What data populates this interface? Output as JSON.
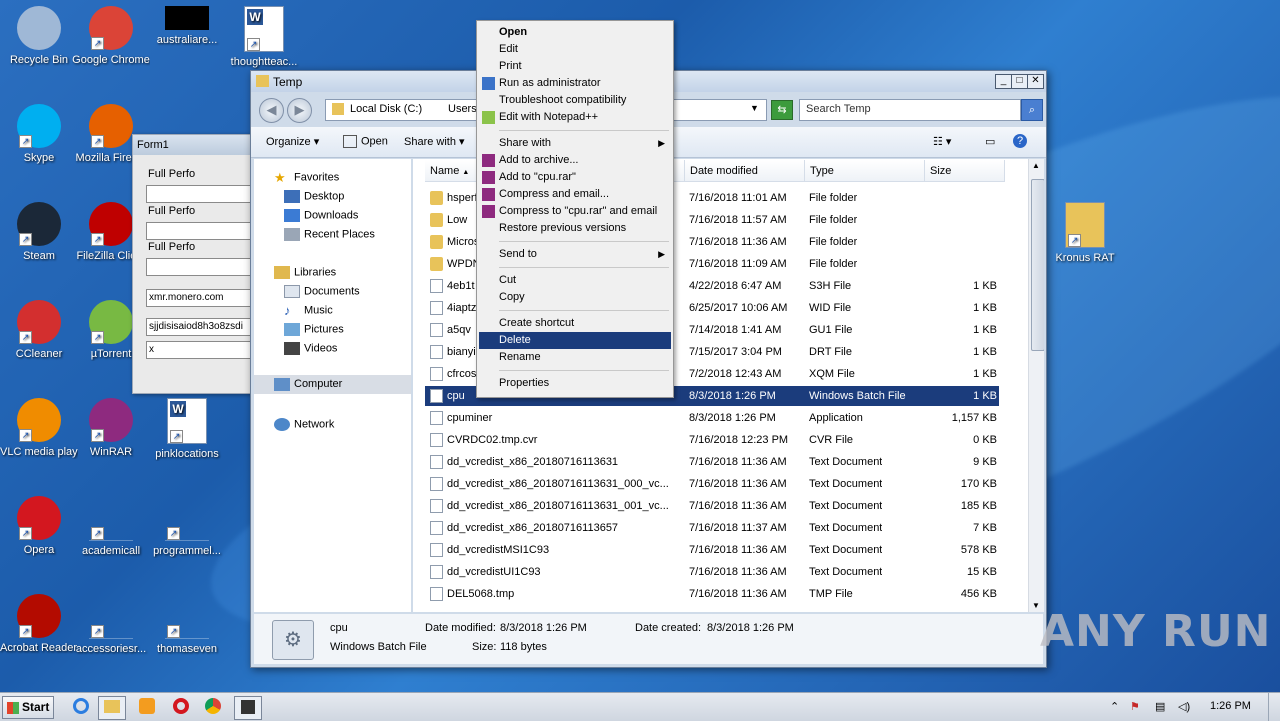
{
  "desktop": {
    "icons": [
      {
        "label": "Recycle Bin",
        "icon": "recycle-bin-icon"
      },
      {
        "label": "Google Chrome",
        "icon": "chrome-icon"
      },
      {
        "label": "australiare...",
        "icon": "blank-icon"
      },
      {
        "label": "thoughtteac...",
        "icon": "word-doc-icon"
      },
      {
        "label": "Skype",
        "icon": "skype-icon"
      },
      {
        "label": "Mozilla Firefox",
        "icon": "firefox-icon"
      },
      {
        "label": "Steam",
        "icon": "steam-icon"
      },
      {
        "label": "FileZilla Client",
        "icon": "filezilla-icon"
      },
      {
        "label": "CCleaner",
        "icon": "ccleaner-icon"
      },
      {
        "label": "µTorrent",
        "icon": "utorrent-icon"
      },
      {
        "label": "VLC media player",
        "icon": "vlc-icon"
      },
      {
        "label": "WinRAR",
        "icon": "winrar-icon"
      },
      {
        "label": "pinklocations",
        "icon": "word-doc-icon"
      },
      {
        "label": "Opera",
        "icon": "opera-icon"
      },
      {
        "label": "academicall",
        "icon": "blank-icon"
      },
      {
        "label": "programmel...",
        "icon": "blank-icon"
      },
      {
        "label": "Acrobat Reader DC",
        "icon": "acrobat-icon"
      },
      {
        "label": "accessoriesr...",
        "icon": "blank-icon"
      },
      {
        "label": "thomaseven",
        "icon": "blank-icon"
      },
      {
        "label": "Kronus RAT",
        "icon": "folder-icon"
      }
    ]
  },
  "form1": {
    "title": "Form1",
    "labels": [
      "Full Perfo",
      "Full Perfo",
      "Full Perfo"
    ],
    "inputs": [
      "",
      "",
      "",
      "xmr.monero.com",
      "sjjdisisaiod8h3o8zsdi",
      "x"
    ]
  },
  "explorer": {
    "title": "Temp",
    "address": [
      "Local Disk (C:)",
      "Users"
    ],
    "search_placeholder": "Search Temp",
    "commands": {
      "organize": "Organize",
      "open": "Open",
      "share": "Share with"
    },
    "nav": {
      "favorites": "Favorites",
      "desktop": "Desktop",
      "downloads": "Downloads",
      "recent": "Recent Places",
      "libraries": "Libraries",
      "documents": "Documents",
      "music": "Music",
      "pictures": "Pictures",
      "videos": "Videos",
      "computer": "Computer",
      "network": "Network"
    },
    "columns": {
      "name": "Name",
      "date": "Date modified",
      "type": "Type",
      "size": "Size"
    },
    "files": [
      {
        "name": "hsperfd",
        "date": "7/16/2018 11:01 AM",
        "type": "File folder",
        "size": "",
        "kind": "folder"
      },
      {
        "name": "Low",
        "date": "7/16/2018 11:57 AM",
        "type": "File folder",
        "size": "",
        "kind": "folder"
      },
      {
        "name": "Micros",
        "date": "7/16/2018 11:36 AM",
        "type": "File folder",
        "size": "",
        "kind": "folder"
      },
      {
        "name": "WPDN",
        "date": "7/16/2018 11:09 AM",
        "type": "File folder",
        "size": "",
        "kind": "folder"
      },
      {
        "name": "4eb1t",
        "date": "4/22/2018 6:47 AM",
        "type": "S3H File",
        "size": "1 KB",
        "kind": "doc"
      },
      {
        "name": "4iaptz",
        "date": "6/25/2017 10:06 AM",
        "type": "WID File",
        "size": "1 KB",
        "kind": "doc"
      },
      {
        "name": "a5qv",
        "date": "7/14/2018 1:41 AM",
        "type": "GU1 File",
        "size": "1 KB",
        "kind": "doc"
      },
      {
        "name": "bianyi",
        "date": "7/15/2017 3:04 PM",
        "type": "DRT File",
        "size": "1 KB",
        "kind": "doc"
      },
      {
        "name": "cfrcos",
        "date": "7/2/2018 12:43 AM",
        "type": "XQM File",
        "size": "1 KB",
        "kind": "doc"
      },
      {
        "name": "cpu",
        "date": "8/3/2018 1:26 PM",
        "type": "Windows Batch File",
        "size": "1 KB",
        "kind": "bat",
        "selected": true
      },
      {
        "name": "cpuminer",
        "date": "8/3/2018 1:26 PM",
        "type": "Application",
        "size": "1,157 KB",
        "kind": "app"
      },
      {
        "name": "CVRDC02.tmp.cvr",
        "date": "7/16/2018 12:23 PM",
        "type": "CVR File",
        "size": "0 KB",
        "kind": "doc"
      },
      {
        "name": "dd_vcredist_x86_20180716113631",
        "date": "7/16/2018 11:36 AM",
        "type": "Text Document",
        "size": "9 KB",
        "kind": "doc"
      },
      {
        "name": "dd_vcredist_x86_20180716113631_000_vc...",
        "date": "7/16/2018 11:36 AM",
        "type": "Text Document",
        "size": "170 KB",
        "kind": "doc"
      },
      {
        "name": "dd_vcredist_x86_20180716113631_001_vc...",
        "date": "7/16/2018 11:36 AM",
        "type": "Text Document",
        "size": "185 KB",
        "kind": "doc"
      },
      {
        "name": "dd_vcredist_x86_20180716113657",
        "date": "7/16/2018 11:37 AM",
        "type": "Text Document",
        "size": "7 KB",
        "kind": "doc"
      },
      {
        "name": "dd_vcredistMSI1C93",
        "date": "7/16/2018 11:36 AM",
        "type": "Text Document",
        "size": "578 KB",
        "kind": "doc"
      },
      {
        "name": "dd_vcredistUI1C93",
        "date": "7/16/2018 11:36 AM",
        "type": "Text Document",
        "size": "15 KB",
        "kind": "doc"
      },
      {
        "name": "DEL5068.tmp",
        "date": "7/16/2018 11:36 AM",
        "type": "TMP File",
        "size": "456 KB",
        "kind": "doc"
      }
    ],
    "details": {
      "name": "cpu",
      "type": "Windows Batch File",
      "modified_label": "Date modified:",
      "modified": "8/3/2018 1:26 PM",
      "created_label": "Date created:",
      "created": "8/3/2018 1:26 PM",
      "size_label": "Size:",
      "size": "118 bytes"
    }
  },
  "context_menu": {
    "items": [
      {
        "label": "Open",
        "bold": true
      },
      {
        "label": "Edit"
      },
      {
        "label": "Print"
      },
      {
        "label": "Run as administrator",
        "icon": "shield-icon"
      },
      {
        "label": "Troubleshoot compatibility"
      },
      {
        "label": "Edit with Notepad++",
        "icon": "notepadpp-icon"
      },
      {
        "sep": true
      },
      {
        "label": "Share with",
        "submenu": true
      },
      {
        "label": "Add to archive...",
        "icon": "winrar-icon"
      },
      {
        "label": "Add to \"cpu.rar\"",
        "icon": "winrar-icon"
      },
      {
        "label": "Compress and email...",
        "icon": "winrar-icon"
      },
      {
        "label": "Compress to \"cpu.rar\" and email",
        "icon": "winrar-icon"
      },
      {
        "label": "Restore previous versions"
      },
      {
        "sep": true
      },
      {
        "label": "Send to",
        "submenu": true
      },
      {
        "sep": true
      },
      {
        "label": "Cut"
      },
      {
        "label": "Copy"
      },
      {
        "sep": true
      },
      {
        "label": "Create shortcut"
      },
      {
        "label": "Delete",
        "selected": true
      },
      {
        "label": "Rename"
      },
      {
        "sep": true
      },
      {
        "label": "Properties"
      }
    ]
  },
  "taskbar": {
    "start": "Start",
    "time": "1:26 PM"
  },
  "watermark": "ANY RUN",
  "colors": {
    "selection": "#1b3c7c",
    "desktop": "#1f63b5"
  }
}
